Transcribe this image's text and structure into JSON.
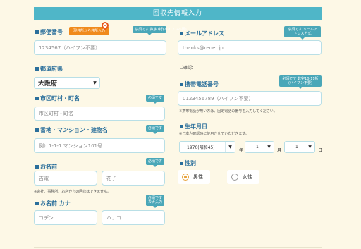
{
  "header": {
    "title": "回収先情報入力"
  },
  "postal": {
    "label": "郵便番号",
    "lookup_button": "現住所から住所入力",
    "required": "必須です 数字7桁(ハイフン不要)",
    "placeholder": "1234567（ハイフン不要）"
  },
  "prefecture": {
    "label": "都道府県",
    "value": "大阪府",
    "caret": "▼"
  },
  "city": {
    "label": "市区町村・町名",
    "required": "必須です",
    "placeholder": "市区町村・町名"
  },
  "address": {
    "label": "番地・マンション・建物名",
    "required": "必須です",
    "placeholder": "例）1-1-1 マンション101号"
  },
  "name": {
    "label": "お名前",
    "required": "必須です",
    "last_placeholder": "吉電",
    "first_placeholder": "花子",
    "note": "※会社、事務所、お店からの回収はできません。"
  },
  "kana": {
    "label": "お名前 カナ",
    "required": "必須です カナ入力",
    "last_placeholder": "コデン",
    "first_placeholder": "ハナコ"
  },
  "email": {
    "label": "メールアドレス",
    "required": "必須です メールアドレス方式",
    "placeholder": "thanks@renet.jp",
    "confirm_label": "ご確認："
  },
  "phone": {
    "label": "携帯電話番号",
    "required": "必須です 数字10-11桁(ハイフン不要)",
    "placeholder": "0123456789（ハイフン不要）",
    "note": "※携帯電話が無い方は、固定電話の番号を入力してください。"
  },
  "birthday": {
    "label": "生年月日",
    "note": "※ご本人確認時に使用させていただきます。",
    "year": "1970(昭和45)",
    "year_unit": "年",
    "month": "1",
    "month_unit": "月",
    "day": "1",
    "day_unit": "日",
    "caret": "▼"
  },
  "gender": {
    "label": "性別",
    "male": "男性",
    "female": "女性"
  }
}
